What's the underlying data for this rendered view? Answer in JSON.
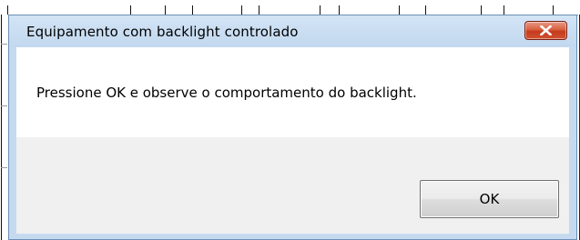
{
  "dialog": {
    "title": "Equipamento com backlight controlado",
    "message": "Pressione OK e observe o comportamento do backlight.",
    "ok_label": "OK",
    "close_icon": "close-icon"
  },
  "colors": {
    "title_bar": "#c6daef",
    "close_button": "#c9452a",
    "content_bg": "#f0f0f0",
    "message_bg": "#ffffff"
  }
}
